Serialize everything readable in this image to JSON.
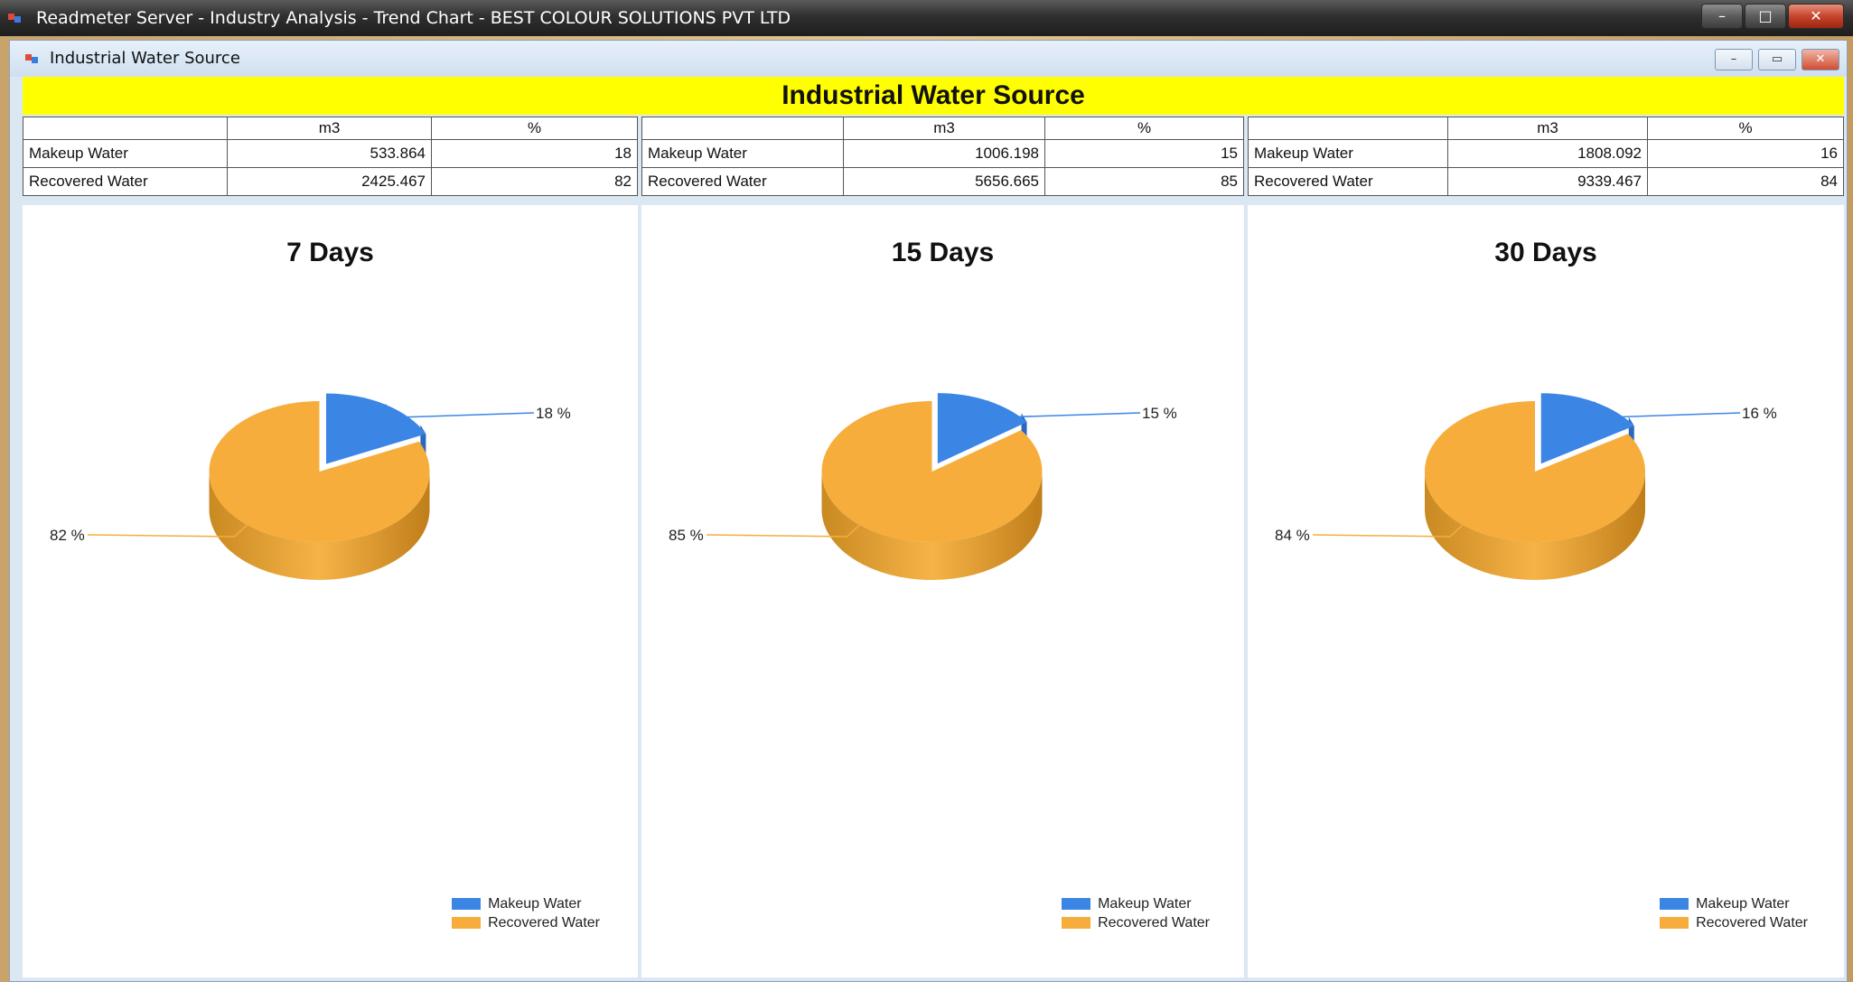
{
  "window": {
    "title": "Readmeter Server - Industry Analysis - Trend Chart - BEST COLOUR SOLUTIONS PVT LTD",
    "buttons": {
      "minimize": "–",
      "restore": "□",
      "close": "✕"
    }
  },
  "child": {
    "title": "Industrial Water Source",
    "buttons": {
      "minimize": "–",
      "restore": "▭",
      "close": "✕"
    }
  },
  "banner": "Industrial Water Source",
  "colors": {
    "makeup": "#3b86e5",
    "recovered": "#f6ad3c",
    "banner": "#ffff00"
  },
  "tables": [
    {
      "headers": [
        "",
        "m3",
        "%"
      ],
      "rows": [
        {
          "label": "Makeup Water",
          "m3": "533.864",
          "pct": "18"
        },
        {
          "label": "Recovered Water",
          "m3": "2425.467",
          "pct": "82"
        }
      ]
    },
    {
      "headers": [
        "",
        "m3",
        "%"
      ],
      "rows": [
        {
          "label": "Makeup Water",
          "m3": "1006.198",
          "pct": "15"
        },
        {
          "label": "Recovered Water",
          "m3": "5656.665",
          "pct": "85"
        }
      ]
    },
    {
      "headers": [
        "",
        "m3",
        "%"
      ],
      "rows": [
        {
          "label": "Makeup Water",
          "m3": "1808.092",
          "pct": "16"
        },
        {
          "label": "Recovered Water",
          "m3": "9339.467",
          "pct": "84"
        }
      ]
    }
  ],
  "chart_data": [
    {
      "type": "pie",
      "title": "7 Days",
      "categories": [
        "Makeup Water",
        "Recovered Water"
      ],
      "values": [
        18,
        82
      ],
      "labels": [
        "18 %",
        "82 %"
      ],
      "legend": "bottom-right"
    },
    {
      "type": "pie",
      "title": "15 Days",
      "categories": [
        "Makeup Water",
        "Recovered Water"
      ],
      "values": [
        15,
        85
      ],
      "labels": [
        "15 %",
        "85 %"
      ],
      "legend": "bottom-right"
    },
    {
      "type": "pie",
      "title": "30 Days",
      "categories": [
        "Makeup Water",
        "Recovered Water"
      ],
      "values": [
        16,
        84
      ],
      "labels": [
        "16 %",
        "84 %"
      ],
      "legend": "bottom-right"
    }
  ]
}
